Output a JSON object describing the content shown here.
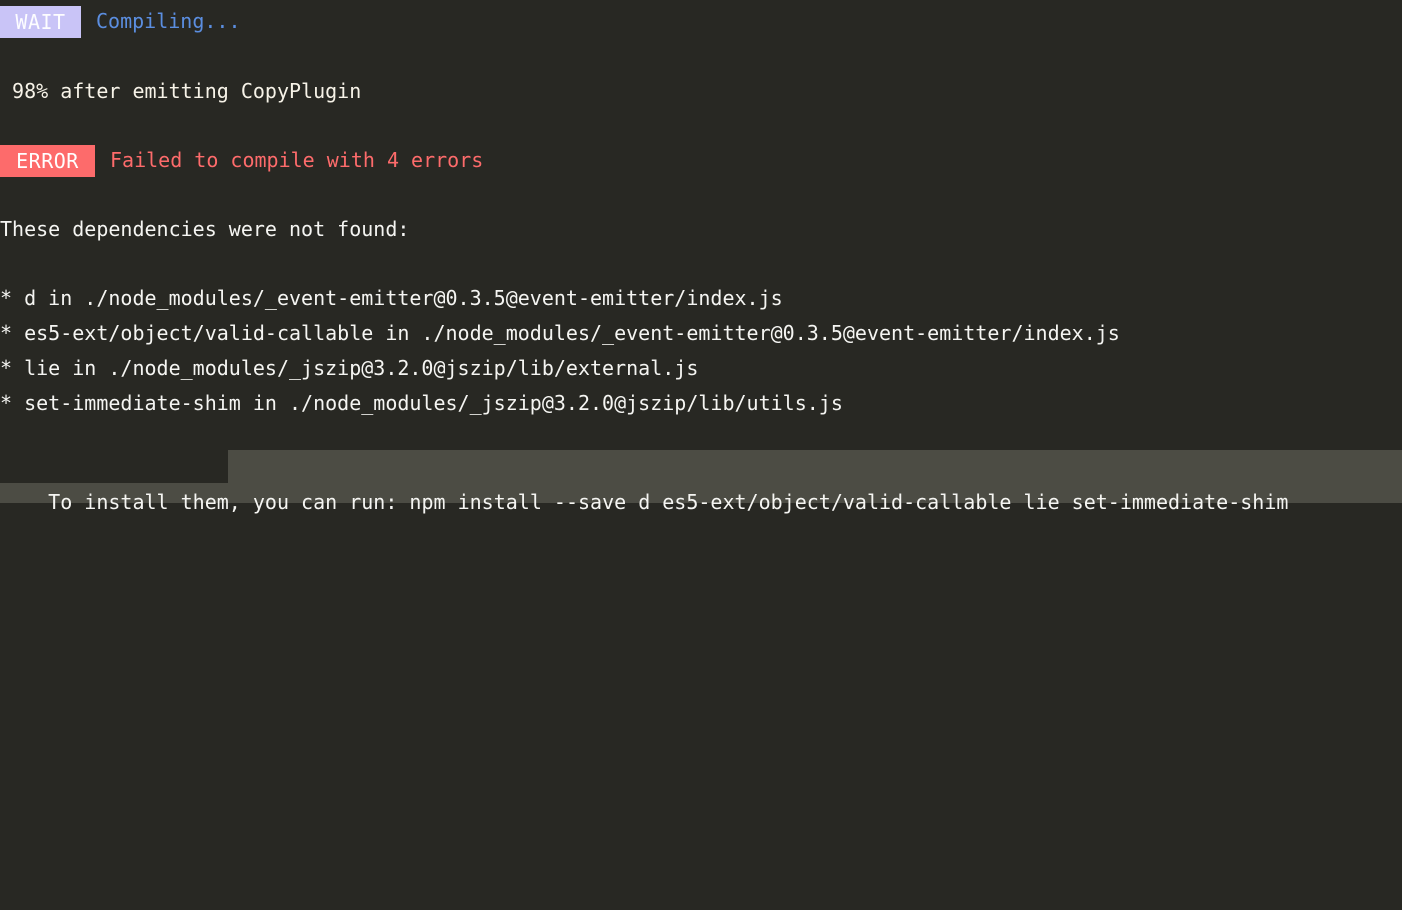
{
  "terminal": {
    "background_color": "#282823",
    "foreground_color": "#f5f5f2",
    "selection_color": "#4c4c44"
  },
  "status": {
    "wait": {
      "badge_label": "WAIT",
      "badge_bg": "#c9c4f7",
      "message": "Compiling...",
      "message_color": "#5b8ee0"
    },
    "error": {
      "badge_label": "ERROR",
      "badge_bg": "#fd6b6b",
      "message": "Failed to compile with 4 errors",
      "message_color": "#fd6b6b"
    }
  },
  "progress": {
    "line": " 98% after emitting CopyPlugin",
    "percent": "98%",
    "stage": "after emitting CopyPlugin"
  },
  "errors": {
    "heading": "These dependencies were not found:",
    "items": [
      "* d in ./node_modules/_event-emitter@0.3.5@event-emitter/index.js",
      "* es5-ext/object/valid-callable in ./node_modules/_event-emitter@0.3.5@event-emitter/index.js",
      "* lie in ./node_modules/_jszip@3.2.0@jszip/lib/external.js",
      "* set-immediate-shim in ./node_modules/_jszip@3.2.0@jszip/lib/utils.js"
    ]
  },
  "hint": {
    "full_line": "To install them, you can run: npm install --save d es5-ext/object/valid-callable lie set-immediate-shim",
    "unselected_prefix": "To install them, ",
    "selected_text": "you can run: npm install --save d es5-ext/object/valid-callable lie set-immediate-shim"
  }
}
